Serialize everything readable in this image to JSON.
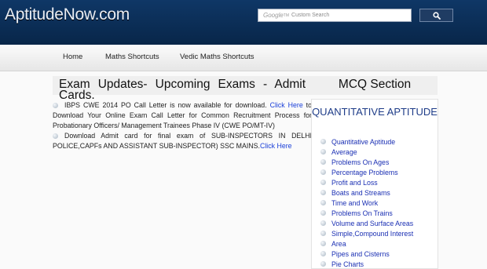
{
  "header": {
    "logo": "AptitudeNow.com",
    "search": {
      "brand": "Google",
      "tm": "TM",
      "placeholder": "Custom Search"
    }
  },
  "nav": {
    "items": [
      "Home",
      "Maths Shortcuts",
      "Vedic Maths Shortcuts"
    ]
  },
  "main": {
    "updates_title": "Exam Updates- Upcoming Exams - Admit",
    "updates_title_cont": "Cards.",
    "news": [
      {
        "text": "IBPS CWE 2014 PO Call Letter is now available for download.",
        "link": "Click Here",
        "tail": " to Download Your Online Exam Call Letter for Common Recruitment Process for Probationary Officers/ Management Trainees Phase IV (CWE PO/MT-IV)"
      },
      {
        "text": "Download Admit card for final exam of SUB-INSPECTORS IN DELHI POLICE,CAPFs AND ASSISTANT SUB-INSPECTOR) SSC MAINS.",
        "link": "Click Here",
        "tail": ""
      }
    ]
  },
  "sidebar": {
    "header": "MCQ Section",
    "section_title": "QUANTITATIVE APTITUDE",
    "items": [
      "Quantitative Aptitude",
      "Average",
      "Problems On Ages",
      "Percentage Problems",
      "Profit and Loss",
      "Boats and Streams",
      "Time and Work",
      "Problems On Trains",
      "Volume and Surface Areas",
      "Simple,Compound Interest",
      "Area",
      "Pipes and Cisterns",
      "Pie Charts"
    ]
  },
  "colors": {
    "header_bg": "#0b2d57",
    "link": "#1a3fd8",
    "sidebar_link": "#1a2fb3",
    "section_title": "#1e3c88"
  }
}
